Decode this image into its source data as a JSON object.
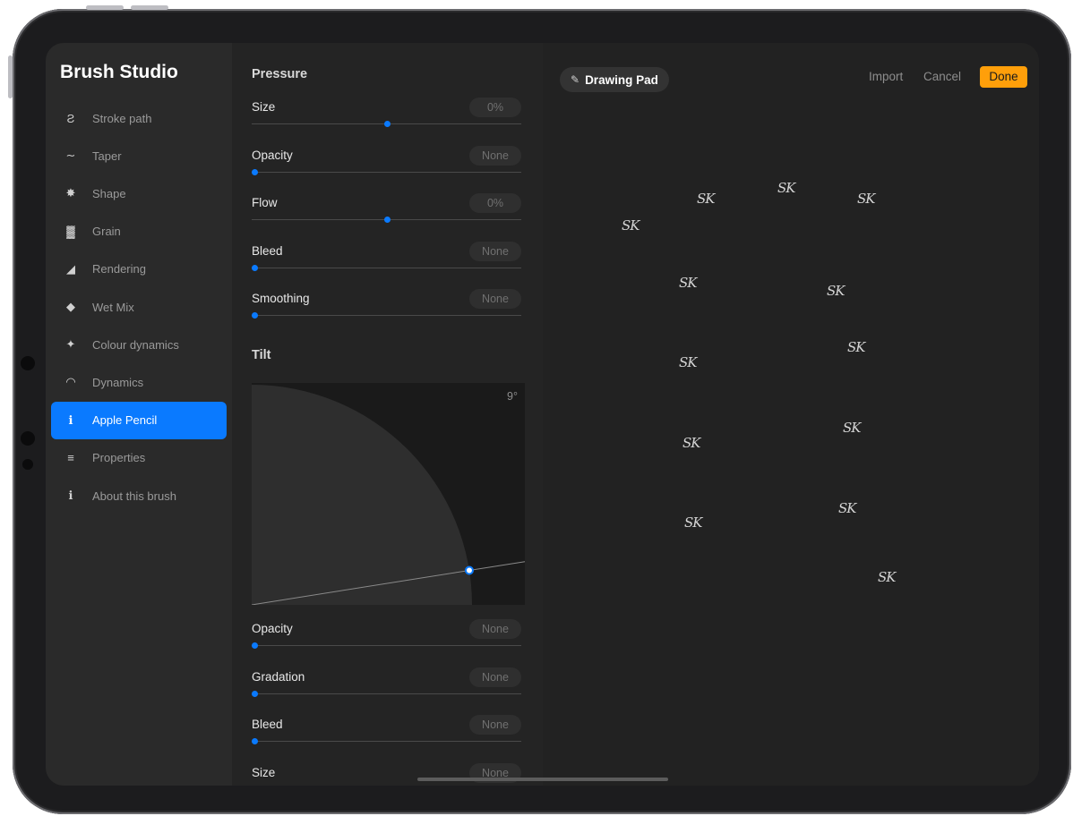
{
  "app_title": "Brush Studio",
  "accent_color": "#0a7aff",
  "done_color": "#ff9f0a",
  "sidebar": {
    "items": [
      {
        "label": "Stroke path",
        "icon": "stroke-path-icon",
        "glyph": "Ƨ"
      },
      {
        "label": "Taper",
        "icon": "taper-icon",
        "glyph": "∼"
      },
      {
        "label": "Shape",
        "icon": "shape-icon",
        "glyph": "✸"
      },
      {
        "label": "Grain",
        "icon": "grain-icon",
        "glyph": "▓"
      },
      {
        "label": "Rendering",
        "icon": "rendering-icon",
        "glyph": "◢"
      },
      {
        "label": "Wet Mix",
        "icon": "wet-mix-icon",
        "glyph": "◆"
      },
      {
        "label": "Colour dynamics",
        "icon": "colour-dynamics-icon",
        "glyph": "✦"
      },
      {
        "label": "Dynamics",
        "icon": "dynamics-icon",
        "glyph": "◠"
      },
      {
        "label": "Apple Pencil",
        "icon": "info-icon",
        "glyph": "ℹ",
        "active": true
      },
      {
        "label": "Properties",
        "icon": "list-icon",
        "glyph": "≡"
      },
      {
        "label": "About this brush",
        "icon": "info-icon",
        "glyph": "ℹ"
      }
    ]
  },
  "pressure": {
    "title": "Pressure",
    "settings": [
      {
        "label": "Size",
        "value": "0%",
        "level": 0.5
      },
      {
        "label": "Opacity",
        "value": "None",
        "level": 0
      },
      {
        "label": "Flow",
        "value": "0%",
        "level": 0.5
      },
      {
        "label": "Bleed",
        "value": "None",
        "level": 0
      },
      {
        "label": "Smoothing",
        "value": "None",
        "level": 0
      }
    ]
  },
  "tilt": {
    "title": "Tilt",
    "angle_label": "9°",
    "angle_deg": 9,
    "settings": [
      {
        "label": "Opacity",
        "value": "None",
        "level": 0
      },
      {
        "label": "Gradation",
        "value": "None",
        "level": 0
      },
      {
        "label": "Bleed",
        "value": "None",
        "level": 0
      },
      {
        "label": "Size",
        "value": "None",
        "level": 0
      }
    ]
  },
  "drawing_pad": {
    "title": "Drawing Pad",
    "import_label": "Import",
    "cancel_label": "Cancel",
    "done_label": "Done",
    "stamp_text": "SK"
  }
}
